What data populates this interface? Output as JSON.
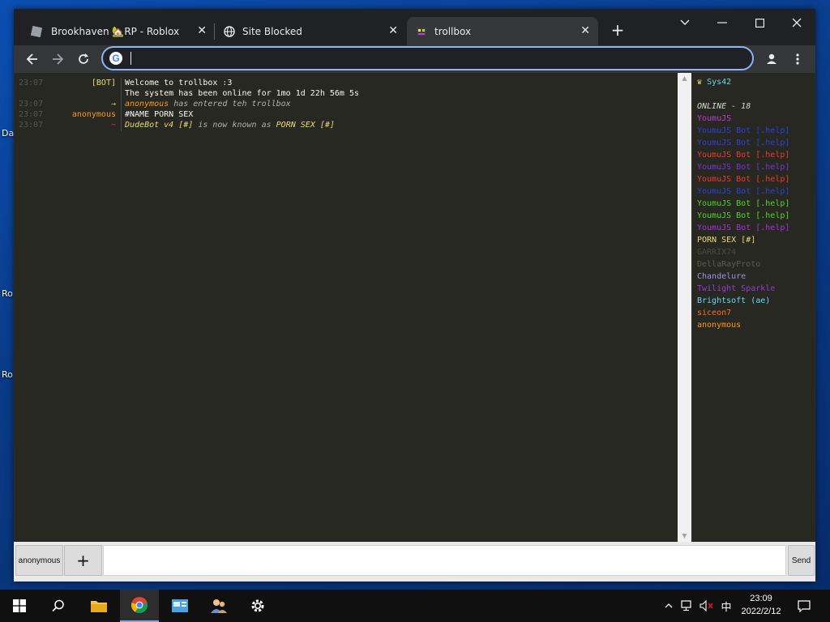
{
  "desktop": {
    "labels": [
      "Da",
      "Ro",
      "Ro"
    ]
  },
  "browser": {
    "tabs": [
      {
        "title": "Brookhaven 🏡RP - Roblox",
        "icon": "roblox-icon"
      },
      {
        "title": "Site Blocked",
        "icon": "globe-icon"
      },
      {
        "title": "trollbox",
        "icon": "trollbox-icon"
      }
    ],
    "address": {
      "value": "",
      "placeholder": ""
    }
  },
  "chat": {
    "messages": [
      {
        "time": "23:07",
        "nick": "[BOT]",
        "nick_color": "#e6db74",
        "text": "Welcome to trollbox :3",
        "text_color": "#f8f8f2",
        "italic": false
      },
      {
        "time": "",
        "nick": "",
        "nick_color": "#e6db74",
        "text": "The system has been online for 1mo 1d 22h 56m 5s",
        "text_color": "#f8f8f2",
        "italic": false
      },
      {
        "time": "23:07",
        "nick": "→",
        "nick_color": "#a6e22e",
        "text_parts": [
          {
            "t": "anonymous",
            "c": "#fd971f"
          },
          {
            "t": " has entered teh trollbox",
            "c": "#b0b0a8"
          }
        ],
        "italic": true
      },
      {
        "time": "23:07",
        "nick": "anonymous",
        "nick_color": "#fd971f",
        "text": "#NAME PORN SEX",
        "text_color": "#f8f8f2",
        "italic": false
      },
      {
        "time": "23:07",
        "nick": "~",
        "nick_color": "#f92672",
        "text_parts": [
          {
            "t": "DudeBot v4 [#]",
            "c": "#e6db74"
          },
          {
            "t": " is now known as ",
            "c": "#b0b0a8"
          },
          {
            "t": "PORN SEX [#]",
            "c": "#e6db74"
          }
        ],
        "italic": true
      }
    ]
  },
  "users": {
    "self": "Sys42",
    "online_label": "ONLINE - 18",
    "list": [
      {
        "name": "YoumuJS",
        "color": "#c33ad6"
      },
      {
        "name": "YoumuJS Bot [.help]",
        "color": "#2f3ee0"
      },
      {
        "name": "YoumuJS Bot [.help]",
        "color": "#2f3ee0"
      },
      {
        "name": "YoumuJS Bot [.help]",
        "color": "#ee3a2a"
      },
      {
        "name": "YoumuJS Bot [.help]",
        "color": "#7a2fe0"
      },
      {
        "name": "YoumuJS Bot [.help]",
        "color": "#ee3a2a"
      },
      {
        "name": "YoumuJS Bot [.help]",
        "color": "#2f3ee0"
      },
      {
        "name": "YoumuJS Bot [.help]",
        "color": "#4fd62a"
      },
      {
        "name": "YoumuJS Bot [.help]",
        "color": "#4fd62a"
      },
      {
        "name": "YoumuJS Bot [.help]",
        "color": "#a82fe0"
      },
      {
        "name": "PORN SEX [#]",
        "color": "#e6db74"
      },
      {
        "name": "GARRIX74",
        "color": "#4a4a40"
      },
      {
        "name": "DellaRayProto",
        "color": "#5b5b50"
      },
      {
        "name": "Chandelure",
        "color": "#a08ee8"
      },
      {
        "name": "Twilight Sparkle",
        "color": "#9b3ad6"
      },
      {
        "name": "Brightsoft (ae)",
        "color": "#66d9ef"
      },
      {
        "name": "siceon7",
        "color": "#fd6a1f"
      },
      {
        "name": "anonymous",
        "color": "#fd971f"
      }
    ]
  },
  "input": {
    "nick_button": "anonymous",
    "plus_button": "+",
    "message_value": "",
    "send_button": "Send"
  },
  "taskbar": {
    "clock_time": "23:09",
    "clock_date": "2022/2/12",
    "ime": "中"
  }
}
